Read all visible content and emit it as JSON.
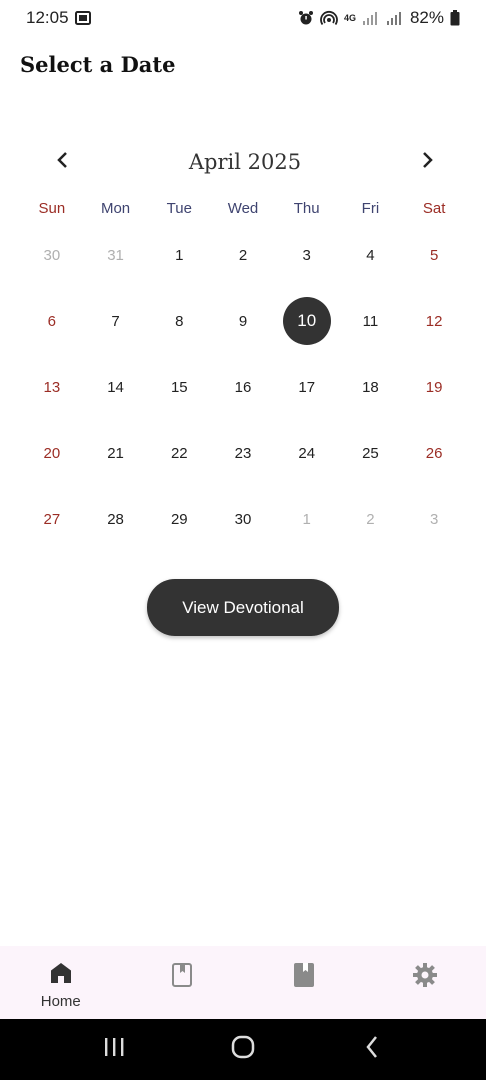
{
  "status_bar": {
    "time": "12:05",
    "network": "4G",
    "battery": "82%"
  },
  "header": {
    "title": "Select a Date"
  },
  "calendar": {
    "month_label": "April 2025",
    "prev_icon": "chevron-left-icon",
    "next_icon": "chevron-right-icon",
    "weekdays": [
      "Sun",
      "Mon",
      "Tue",
      "Wed",
      "Thu",
      "Fri",
      "Sat"
    ],
    "days": [
      {
        "label": "30",
        "muted": true
      },
      {
        "label": "31",
        "muted": true
      },
      {
        "label": "1"
      },
      {
        "label": "2"
      },
      {
        "label": "3"
      },
      {
        "label": "4"
      },
      {
        "label": "5"
      },
      {
        "label": "6"
      },
      {
        "label": "7"
      },
      {
        "label": "8"
      },
      {
        "label": "9"
      },
      {
        "label": "10",
        "selected": true
      },
      {
        "label": "11"
      },
      {
        "label": "12"
      },
      {
        "label": "13"
      },
      {
        "label": "14"
      },
      {
        "label": "15"
      },
      {
        "label": "16"
      },
      {
        "label": "17"
      },
      {
        "label": "18"
      },
      {
        "label": "19"
      },
      {
        "label": "20"
      },
      {
        "label": "21"
      },
      {
        "label": "22"
      },
      {
        "label": "23"
      },
      {
        "label": "24"
      },
      {
        "label": "25"
      },
      {
        "label": "26"
      },
      {
        "label": "27"
      },
      {
        "label": "28"
      },
      {
        "label": "29"
      },
      {
        "label": "30"
      },
      {
        "label": "1",
        "muted": true
      },
      {
        "label": "2",
        "muted": true
      },
      {
        "label": "3",
        "muted": true
      }
    ],
    "colors": {
      "weekend": "#9b2d25",
      "weekday_header": "#3f4470",
      "selected_bg": "#333333",
      "muted": "#b0b0b0"
    }
  },
  "actions": {
    "view_devotional_label": "View Devotional"
  },
  "bottom_nav": {
    "items": [
      {
        "icon": "home-icon",
        "label": "Home",
        "active": true
      },
      {
        "icon": "bookmark-outline-icon",
        "label": ""
      },
      {
        "icon": "bookmark-filled-icon",
        "label": ""
      },
      {
        "icon": "gear-icon",
        "label": ""
      }
    ],
    "background": "#fcf4fb"
  },
  "system_nav": {
    "items": [
      "recents-icon",
      "home-circle-icon",
      "back-icon"
    ]
  }
}
